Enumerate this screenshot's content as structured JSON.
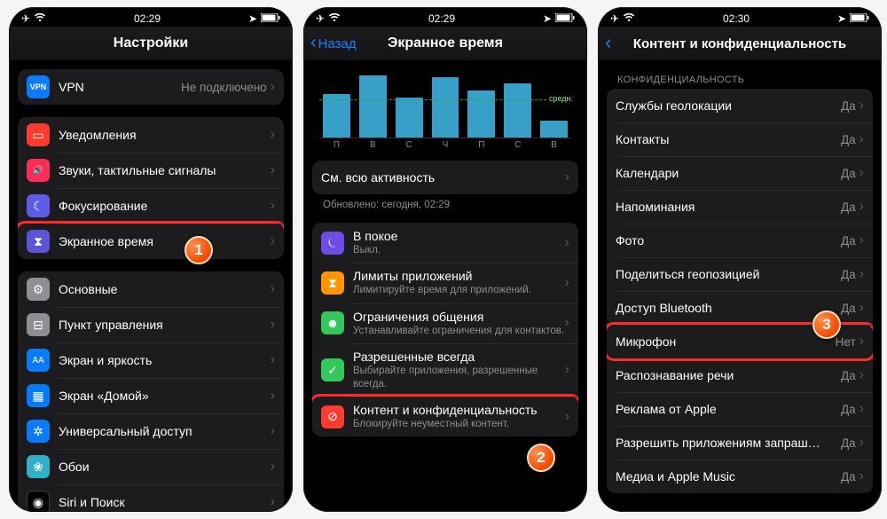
{
  "status": {
    "time_a": "02:29",
    "time_b": "02:29",
    "time_c": "02:30"
  },
  "panel1": {
    "title": "Настройки",
    "vpn": {
      "label": "VPN",
      "value": "Не подключено",
      "icon": "VPN"
    },
    "g1": [
      {
        "label": "Уведомления",
        "bg": "bg-red",
        "glyph": "▭"
      },
      {
        "label": "Звуки, тактильные сигналы",
        "bg": "bg-pink",
        "glyph": "🔊"
      },
      {
        "label": "Фокусирование",
        "bg": "bg-moon",
        "glyph": "☾"
      },
      {
        "label": "Экранное время",
        "bg": "bg-indigo",
        "glyph": "⧗"
      }
    ],
    "g2": [
      {
        "label": "Основные",
        "bg": "bg-gray",
        "glyph": "⚙"
      },
      {
        "label": "Пункт управления",
        "bg": "bg-gray",
        "glyph": "⊟"
      },
      {
        "label": "Экран и яркость",
        "bg": "bg-blue",
        "glyph": "AA"
      },
      {
        "label": "Экран «Домой»",
        "bg": "bg-grid",
        "glyph": "▦"
      },
      {
        "label": "Универсальный доступ",
        "bg": "bg-blue",
        "glyph": "✲"
      },
      {
        "label": "Обои",
        "bg": "bg-teal",
        "glyph": "❀"
      },
      {
        "label": "Siri и Поиск",
        "bg": "bg-black",
        "glyph": "◉"
      }
    ]
  },
  "panel2": {
    "back": "Назад",
    "title": "Экранное время",
    "chart_days": [
      "П",
      "В",
      "С",
      "Ч",
      "П",
      "С",
      "В"
    ],
    "avg": "средн.",
    "see_all": "См. всю активность",
    "updated": "Обновлено: сегодня, 02:29",
    "items": [
      {
        "label": "В покое",
        "sub": "Выкл.",
        "bg": "bg-purple",
        "glyph": "⏾"
      },
      {
        "label": "Лимиты приложений",
        "sub": "Лимитируйте время для приложений.",
        "bg": "bg-orange",
        "glyph": "⧗"
      },
      {
        "label": "Ограничения общения",
        "sub": "Устанавливайте ограничения для контактов.",
        "bg": "bg-green",
        "glyph": "☻"
      },
      {
        "label": "Разрешенные всегда",
        "sub": "Выбирайте приложения, разрешенные всегда.",
        "bg": "bg-green",
        "glyph": "✓"
      },
      {
        "label": "Контент и конфиденциальность",
        "sub": "Блокируйте неуместный контент.",
        "bg": "bg-redstop",
        "glyph": "⊘"
      }
    ]
  },
  "panel3": {
    "title": "Контент и конфиденциальность",
    "section": "КОНФИДЕНЦИАЛЬНОСТЬ",
    "items": [
      {
        "label": "Службы геолокации",
        "value": "Да"
      },
      {
        "label": "Контакты",
        "value": "Да"
      },
      {
        "label": "Календари",
        "value": "Да"
      },
      {
        "label": "Напоминания",
        "value": "Да"
      },
      {
        "label": "Фото",
        "value": "Да"
      },
      {
        "label": "Поделиться геопозицией",
        "value": "Да"
      },
      {
        "label": "Доступ Bluetooth",
        "value": "Да"
      },
      {
        "label": "Микрофон",
        "value": "Нет"
      },
      {
        "label": "Распознавание речи",
        "value": "Да"
      },
      {
        "label": "Реклама от Apple",
        "value": "Да"
      },
      {
        "label": "Разрешить приложениям запраш…",
        "value": "Да"
      },
      {
        "label": "Медиа и Apple Music",
        "value": "Да"
      }
    ]
  },
  "chart_data": {
    "type": "bar",
    "categories": [
      "П",
      "В",
      "С",
      "Ч",
      "П",
      "С",
      "В"
    ],
    "values": [
      52,
      74,
      48,
      72,
      56,
      64,
      20
    ],
    "avg_label": "средн.",
    "title": "Экранное время",
    "ylim": [
      0,
      80
    ]
  }
}
